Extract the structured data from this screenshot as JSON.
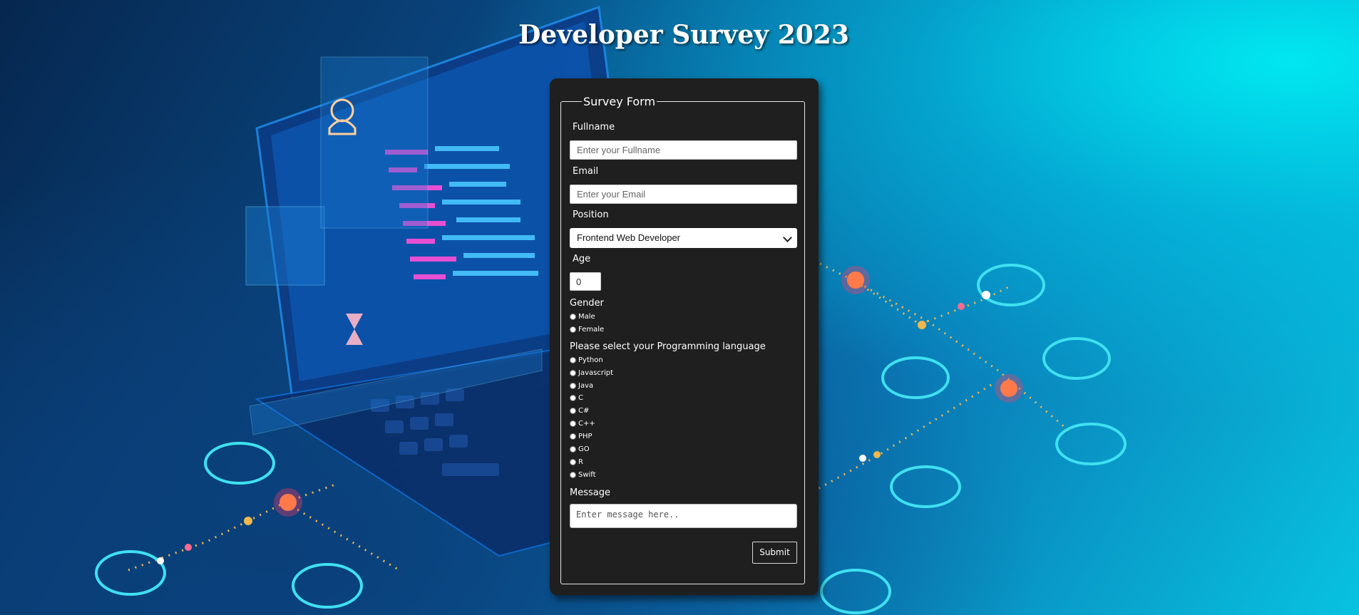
{
  "page": {
    "title": "Developer Survey 2023"
  },
  "form": {
    "legend": "Survey Form",
    "fullname": {
      "label": "Fullname",
      "placeholder": "Enter your Fullname",
      "value": ""
    },
    "email": {
      "label": "Email",
      "placeholder": "Enter your Email",
      "value": ""
    },
    "position": {
      "label": "Position",
      "selected": "Frontend Web Developer"
    },
    "age": {
      "label": "Age",
      "value": "0"
    },
    "gender": {
      "label": "Gender",
      "options": [
        "Male",
        "Female"
      ]
    },
    "languages": {
      "label": "Please select your Programming language",
      "options": [
        "Python",
        "Javascript",
        "Java",
        "C",
        "C#",
        "C++",
        "PHP",
        "GO",
        "R",
        "Swift"
      ]
    },
    "message": {
      "label": "Message",
      "placeholder": "Enter message here.."
    },
    "submit_label": "Submit"
  },
  "colors": {
    "card": "#1f1f1f",
    "accent_glow": "#00e7f0",
    "node_red": "#ff3b6b",
    "line_cyan": "#3fe0f0"
  }
}
